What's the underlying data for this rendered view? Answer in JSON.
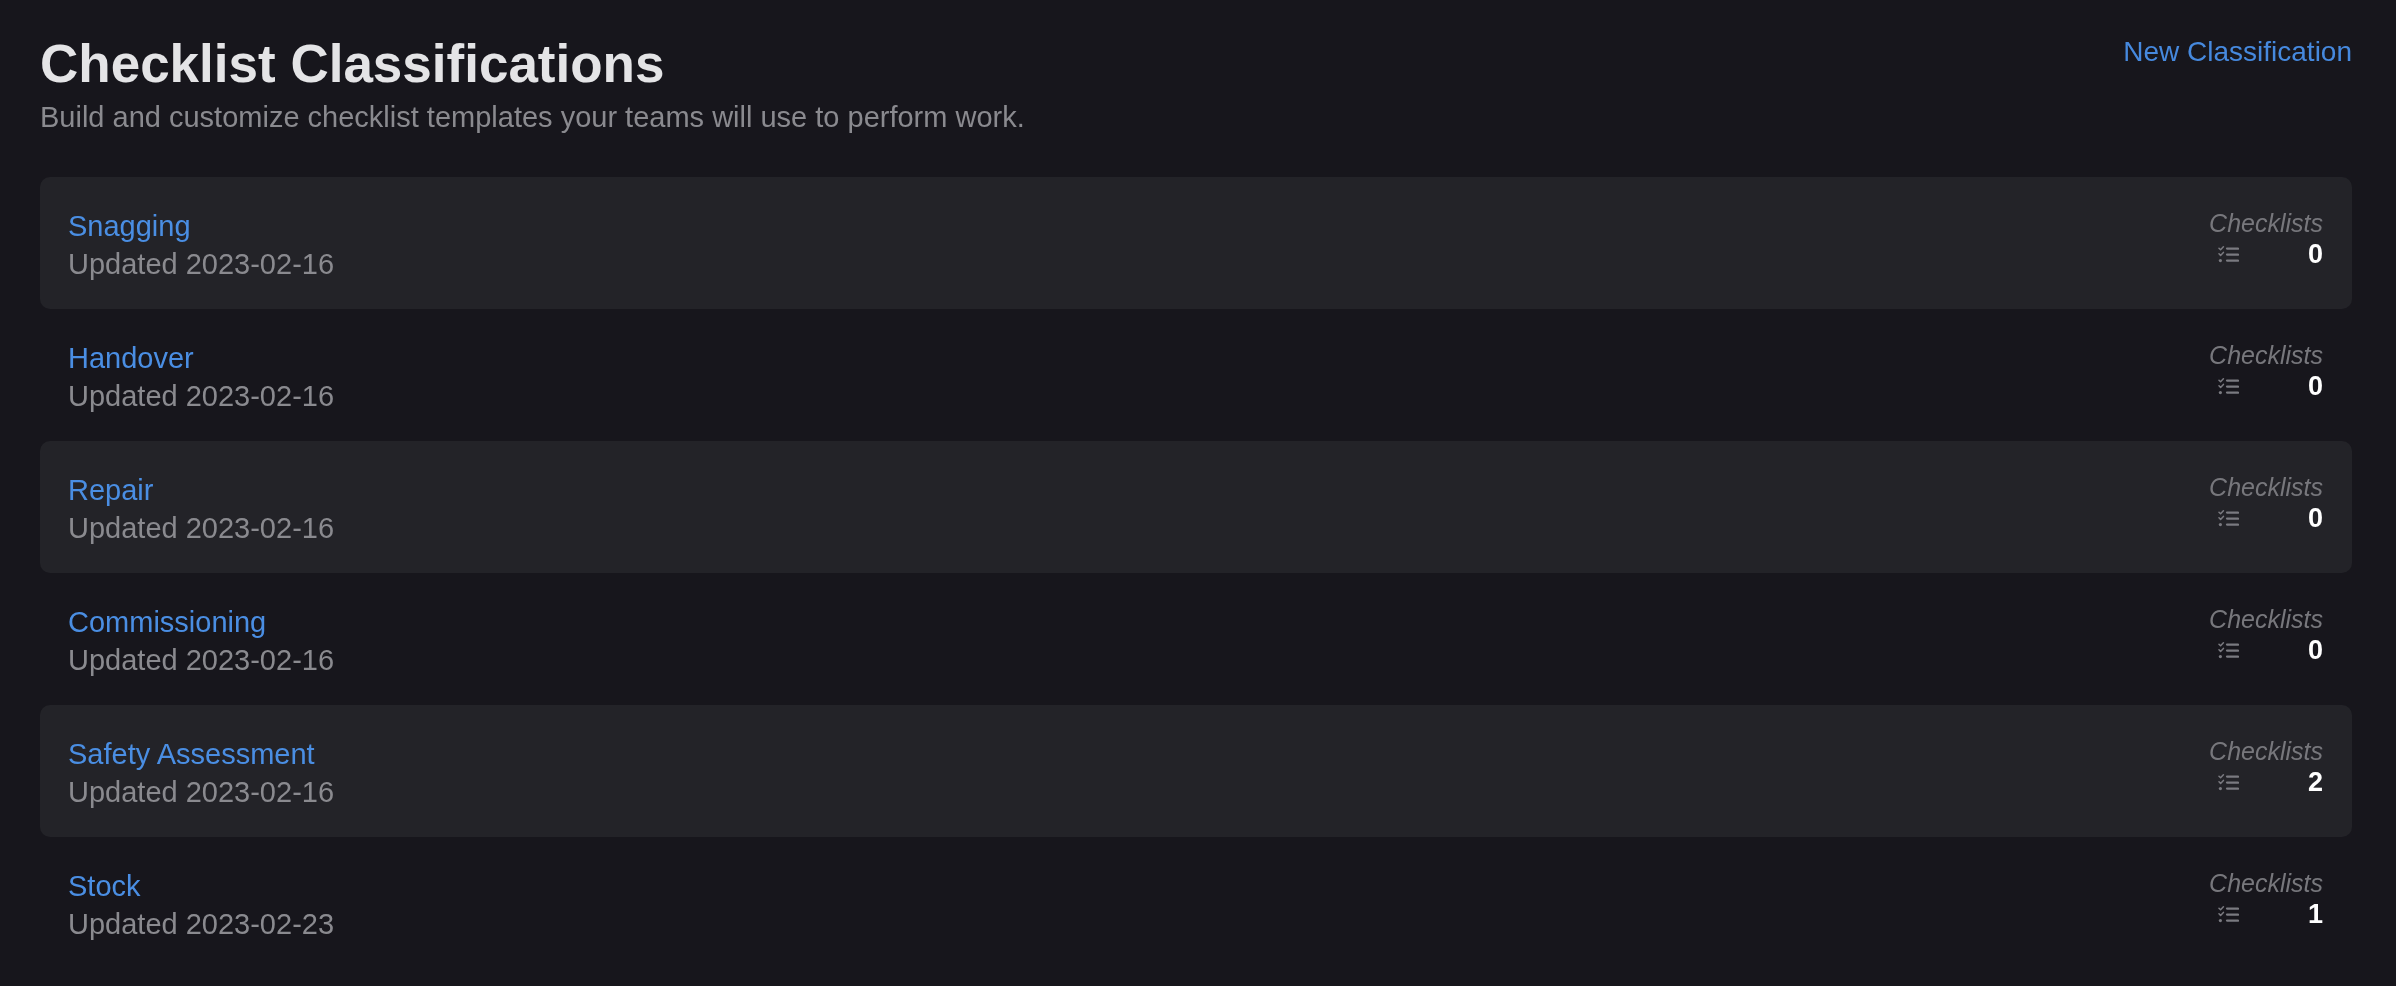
{
  "header": {
    "title": "Checklist Classifications",
    "subtitle": "Build and customize checklist templates your teams will use to perform work.",
    "action": "New Classification"
  },
  "classifications": [
    {
      "name": "Snagging",
      "updated": "Updated 2023-02-16",
      "count_label": "Checklists",
      "count": "0"
    },
    {
      "name": "Handover",
      "updated": "Updated 2023-02-16",
      "count_label": "Checklists",
      "count": "0"
    },
    {
      "name": "Repair",
      "updated": "Updated 2023-02-16",
      "count_label": "Checklists",
      "count": "0"
    },
    {
      "name": "Commissioning",
      "updated": "Updated 2023-02-16",
      "count_label": "Checklists",
      "count": "0"
    },
    {
      "name": "Safety Assessment",
      "updated": "Updated 2023-02-16",
      "count_label": "Checklists",
      "count": "2"
    },
    {
      "name": "Stock",
      "updated": "Updated 2023-02-23",
      "count_label": "Checklists",
      "count": "1"
    }
  ]
}
